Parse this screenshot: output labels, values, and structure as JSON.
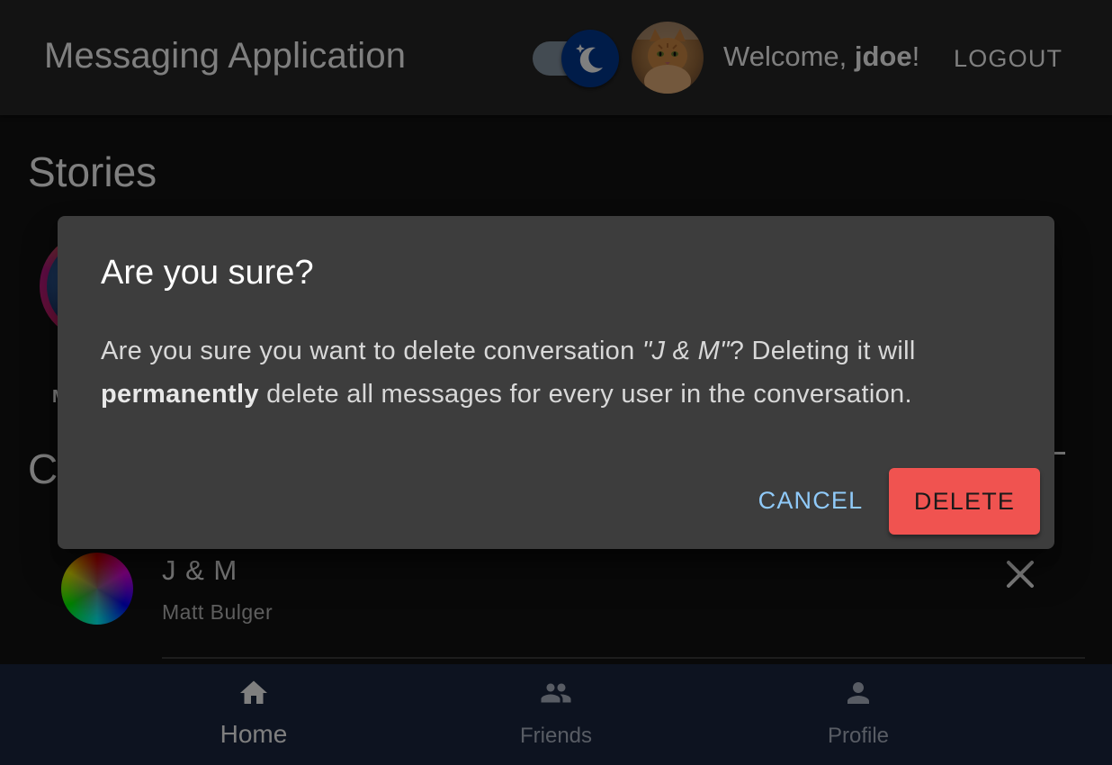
{
  "appbar": {
    "title": "Messaging Application",
    "welcome_prefix": "Welcome, ",
    "username": "jdoe",
    "welcome_suffix": "!",
    "logout_label": "LOGOUT",
    "theme_mode": "dark"
  },
  "main": {
    "stories_title": "Stories",
    "story_label_partial": "M",
    "conversations_title_partial": "C",
    "conversations": [
      {
        "name": "J & M",
        "subtitle": "Matt Bulger"
      }
    ]
  },
  "dialog": {
    "title": "Are you sure?",
    "text_part1": "Are you sure you want to delete conversation ",
    "conversation_name": "\"J & M\"",
    "text_part2": "? Deleting it will ",
    "emphasis": "permanently",
    "text_part3": " delete all messages for every user in the conversation.",
    "cancel_label": "CANCEL",
    "delete_label": "DELETE"
  },
  "bottom_nav": {
    "items": [
      {
        "label": "Home",
        "icon": "home-icon",
        "active": true
      },
      {
        "label": "Friends",
        "icon": "people-icon",
        "active": false
      },
      {
        "label": "Profile",
        "icon": "person-icon",
        "active": false
      }
    ]
  },
  "colors": {
    "appbar_bg": "#272727",
    "bottom_nav_bg": "#1a2740",
    "dialog_bg": "#3d3d3d",
    "cancel_text": "#90caf9",
    "delete_bg": "#f05350",
    "toggle_thumb": "#003892"
  }
}
